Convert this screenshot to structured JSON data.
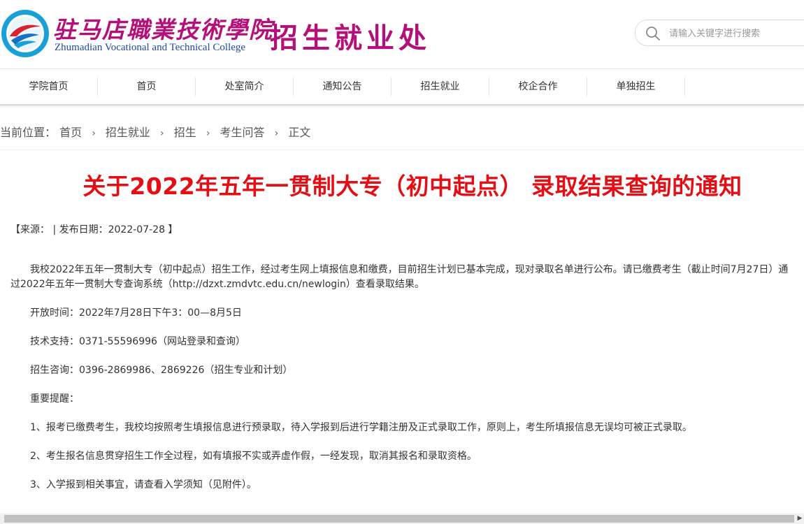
{
  "header": {
    "college_name_cn": "驻马店職業技術學院",
    "college_name_en": "Zhumadian Vocational and Technical College",
    "department": "招生就业处",
    "search_placeholder": "请输入关键字进行搜索"
  },
  "nav": {
    "items": [
      {
        "label": "学院首页"
      },
      {
        "label": "首页"
      },
      {
        "label": "处室简介"
      },
      {
        "label": "通知公告"
      },
      {
        "label": "招生就业"
      },
      {
        "label": "校企合作"
      },
      {
        "label": "单独招生"
      }
    ]
  },
  "breadcrumb": {
    "prefix": "当前位置：",
    "items": [
      "首页",
      "招生就业",
      "招生",
      "考生问答",
      "正文"
    ],
    "separator": "›"
  },
  "article": {
    "title": "关于2022年五年一贯制大专（初中起点） 录取结果查询的通知",
    "meta": "【来源： | 发布日期：2022-07-28 】",
    "paragraphs": [
      "我校2022年五年一贯制大专（初中起点）招生工作，经过考生网上填报信息和缴费，目前招生计划已基本完成，现对录取名单进行公布。请已缴费考生（截止时间7月27日）通过2022年五年一贯制大专查询系统（http://dzxt.zmdvtc.edu.cn/newlogin）查看录取结果。",
      "开放时间：2022年7月28日下午3：00—8月5日",
      "技术支持：0371-55596996（网站登录和查询）",
      "招生咨询：0396-2869986、2869226（招生专业和计划）",
      "重要提醒：",
      "1、报考已缴费考生，我校均按照考生填报信息进行预录取，待入学报到后进行学籍注册及正式录取工作，原则上，考生所填报信息无误均可被正式录取。",
      "2、考生报名信息贯穿招生工作全过程，如有填报不实或弄虚作假，一经发现，取消其报名和录取资格。",
      "3、入学报到相关事宜，请查看入学须知（见附件）。"
    ]
  },
  "colors": {
    "brand_magenta": "#b4107a",
    "title_red": "#e50e14",
    "english_blue": "#1e4aa6"
  },
  "icons": {
    "search": "search-icon",
    "logo": "college-emblem-icon",
    "scroll_right": "scroll-right-arrow-icon"
  }
}
